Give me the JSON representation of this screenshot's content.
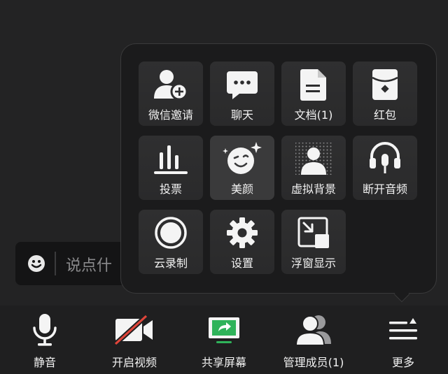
{
  "chat": {
    "placeholder": "说点什么",
    "visible_text": "说点什"
  },
  "more_menu": {
    "items": [
      {
        "label": "微信邀请",
        "icon": "wechat-invite-icon"
      },
      {
        "label": "聊天",
        "icon": "chat-bubble-icon"
      },
      {
        "label": "文档(1)",
        "icon": "document-icon"
      },
      {
        "label": "红包",
        "icon": "red-packet-icon"
      },
      {
        "label": "投票",
        "icon": "vote-icon"
      },
      {
        "label": "美颜",
        "icon": "beauty-icon"
      },
      {
        "label": "虚拟背景",
        "icon": "virtual-background-icon"
      },
      {
        "label": "断开音频",
        "icon": "headset-icon"
      },
      {
        "label": "云录制",
        "icon": "cloud-record-icon"
      },
      {
        "label": "设置",
        "icon": "gear-icon"
      },
      {
        "label": "浮窗显示",
        "icon": "floating-window-icon"
      }
    ]
  },
  "toolbar": {
    "items": [
      {
        "label": "静音",
        "icon": "microphone-icon"
      },
      {
        "label": "开启视频",
        "icon": "video-off-icon"
      },
      {
        "label": "共享屏幕",
        "icon": "share-screen-icon"
      },
      {
        "label": "管理成员(1)",
        "icon": "members-icon"
      },
      {
        "label": "更多",
        "icon": "more-menu-icon"
      }
    ]
  },
  "colors": {
    "background": "#232324",
    "panel": "#1b1b1c",
    "tile": "#2f2f30",
    "share_green": "#2fb35a",
    "video_off_red": "#e0453a"
  }
}
